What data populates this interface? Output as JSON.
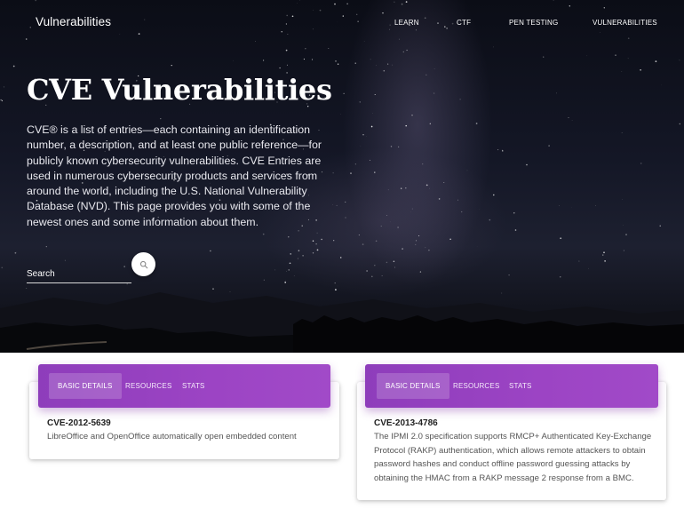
{
  "header": {
    "brand": "Vulnerabilities",
    "nav": [
      "LEARN",
      "CTF",
      "PEN TESTING",
      "VULNERABILITIES"
    ]
  },
  "hero": {
    "title": "CVE Vulnerabilities",
    "description": "CVE® is a list of entries—each containing an identification number, a description, and at least one public reference—for publicly known cybersecurity vulnerabilities. CVE Entries are used in numerous cybersecurity products and services from around the world, including the U.S. National Vulnerability Database (NVD). This page provides you with some of the newest ones and some information about them."
  },
  "search": {
    "placeholder": "Search",
    "button_icon": "search-icon"
  },
  "colors": {
    "accent": "#9b42c3",
    "hero_bg": "#141726"
  },
  "cards": [
    {
      "tabs": [
        "BASIC DETAILS",
        "RESOURCES",
        "STATS"
      ],
      "active_tab": "BASIC DETAILS",
      "id": "CVE-2012-5639",
      "description": "LibreOffice and OpenOffice automatically open embedded content"
    },
    {
      "tabs": [
        "BASIC DETAILS",
        "RESOURCES",
        "STATS"
      ],
      "active_tab": "BASIC DETAILS",
      "id": "CVE-2013-4786",
      "description": "The IPMI 2.0 specification supports RMCP+ Authenticated Key-Exchange Protocol (RAKP) authentication, which allows remote attackers to obtain password hashes and conduct offline password guessing attacks by obtaining the HMAC from a RAKP message 2 response from a BMC."
    }
  ]
}
